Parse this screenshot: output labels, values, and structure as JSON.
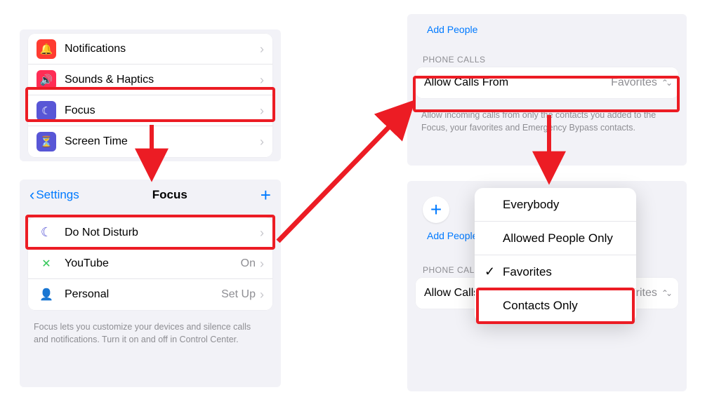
{
  "colors": {
    "highlight": "#ec1c24",
    "link": "#007aff",
    "notif": "#ff3b30",
    "sound": "#ff2d55",
    "focus": "#5856d6",
    "screentime": "#5856d6",
    "moon": "#5856d6",
    "personal": "#af52de"
  },
  "panel1": {
    "rows": [
      {
        "label": "Notifications"
      },
      {
        "label": "Sounds & Haptics"
      },
      {
        "label": "Focus"
      },
      {
        "label": "Screen Time"
      }
    ]
  },
  "panel2": {
    "back": "Settings",
    "title": "Focus",
    "rows": [
      {
        "label": "Do Not Disturb",
        "value": ""
      },
      {
        "label": "YouTube",
        "value": "On"
      },
      {
        "label": "Personal",
        "value": "Set Up"
      }
    ],
    "footer": "Focus lets you customize your devices and silence calls and notifications. Turn it on and off in Control Center."
  },
  "panel3": {
    "addPeople": "Add People",
    "sectionHeader": "PHONE CALLS",
    "allowLabel": "Allow Calls From",
    "allowValue": "Favorites",
    "footer": "Allow incoming calls from only the contacts you added to the Focus, your favorites and Emergency Bypass contacts."
  },
  "panel4": {
    "plusLabel": "+",
    "addPeople": "Add People",
    "sectionHeader": "PHONE CALLS",
    "allowLabel": "Allow Calls From",
    "allowValue": "Favorites",
    "menu": [
      {
        "label": "Everybody",
        "checked": false
      },
      {
        "label": "Allowed People Only",
        "checked": false
      },
      {
        "label": "Favorites",
        "checked": true
      },
      {
        "label": "Contacts Only",
        "checked": false
      }
    ]
  }
}
